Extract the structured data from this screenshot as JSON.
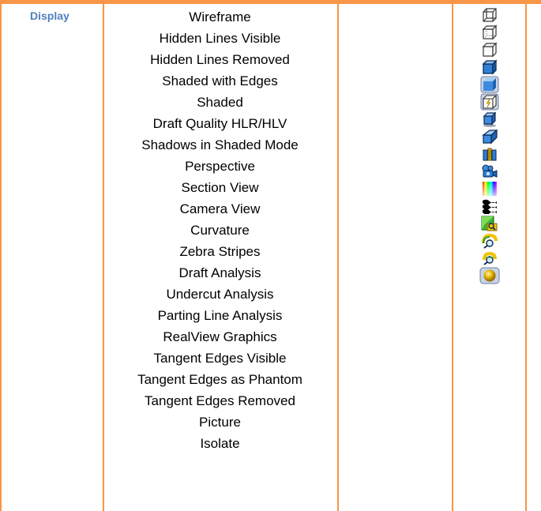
{
  "table": {
    "category_label": "Display",
    "items": [
      "Wireframe",
      "Hidden Lines Visible",
      "Hidden Lines Removed",
      "Shaded with Edges",
      "Shaded",
      "Draft Quality HLR/HLV",
      "Shadows in Shaded Mode",
      "Perspective",
      "Section View",
      "Camera View",
      "Curvature",
      "Zebra Stripes",
      "Draft Analysis",
      "Undercut Analysis",
      "Parting Line Analysis",
      "RealView Graphics",
      "Tangent Edges Visible",
      "Tangent Edges as Phantom",
      "Tangent Edges Removed",
      "Picture",
      "Isolate"
    ],
    "icons": [
      "wireframe-icon",
      "hidden-lines-visible-icon",
      "hidden-lines-removed-icon",
      "shaded-with-edges-icon",
      "shaded-icon",
      "draft-quality-icon",
      "shadows-icon",
      "perspective-icon",
      "section-view-icon",
      "camera-view-icon",
      "curvature-icon",
      "zebra-stripes-icon",
      "draft-analysis-icon",
      "undercut-analysis-icon",
      "parting-line-analysis-icon",
      "realview-graphics-icon"
    ]
  },
  "colors": {
    "border": "#f79646",
    "category_text": "#4f81bd"
  }
}
